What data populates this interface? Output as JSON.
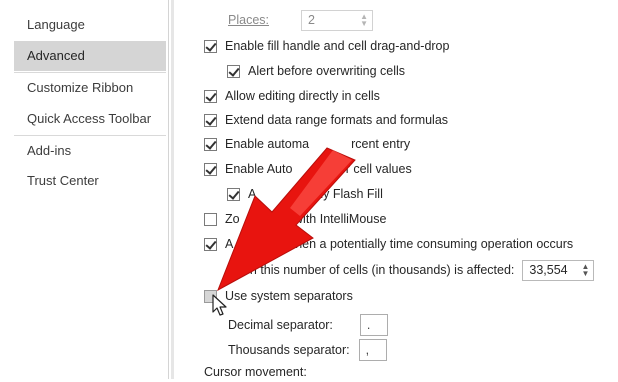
{
  "sidebar": {
    "items": [
      {
        "label": "Language"
      },
      {
        "label": "Advanced"
      },
      {
        "label": "Customize Ribbon"
      },
      {
        "label": "Quick Access Toolbar"
      },
      {
        "label": "Add-ins"
      },
      {
        "label": "Trust Center"
      }
    ]
  },
  "options": {
    "places": {
      "label": "Places:",
      "value": "2"
    },
    "fill_handle": {
      "label": "Enable fill handle and cell drag-and-drop",
      "checked": true
    },
    "alert_overwrite": {
      "label": "Alert before overwriting cells",
      "checked": true
    },
    "allow_editing": {
      "label": "Allow editing directly in cells",
      "checked": true
    },
    "extend_formats": {
      "label": "Extend data range formats and formulas",
      "checked": true
    },
    "auto_percent": {
      "label_visible_left": "Enable automa",
      "label_visible_right": "rcent entry",
      "checked": true
    },
    "autocomplete": {
      "label_visible_left": "Enable Auto",
      "label_visible_right": "ete for cell values",
      "checked": true
    },
    "flash_fill": {
      "label_visible_left": "A",
      "label_visible_right": "ly Flash Fill",
      "checked": true
    },
    "zoom_roll": {
      "label_visible_left": "Zo",
      "label_visible_right": "d with IntelliMouse",
      "checked": false
    },
    "alert_slow": {
      "label_visible_left": "A",
      "label_visible_right": "ser when a potentially time consuming operation occurs",
      "checked": true
    },
    "cells_affected": {
      "label_visible": "hen this number of cells (in thousands) is affected:",
      "value": "33,554"
    },
    "system_separators": {
      "label": "Use system separators",
      "checked": false
    },
    "decimal_separator": {
      "label": "Decimal separator:",
      "value": "."
    },
    "thousands_separator": {
      "label": "Thousands separator:",
      "value": ","
    },
    "cursor_movement": {
      "label": "Cursor movement:"
    }
  },
  "colors": {
    "arrow": "#e8140f",
    "selected_nav": "#d5d5d5"
  },
  "icons": [
    "checkbox-icon",
    "spinner-arrows-icon",
    "red-arrow-annotation",
    "mouse-cursor-icon"
  ]
}
